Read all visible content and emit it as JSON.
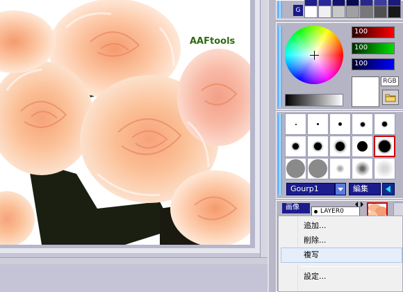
{
  "canvas": {
    "watermark": "AAFtools"
  },
  "swatches": {
    "group_label": "G",
    "colors": [
      "#ffffff",
      "#f4f4f4",
      "#c8c8c8",
      "#a0a0a0",
      "#787878",
      "#505050",
      "#282828",
      "#000000"
    ],
    "top_row": [
      "#1e1e8c",
      "#2828a0",
      "#14146e",
      "#0a0a50",
      "#28288c",
      "#3c3ca0",
      "#1a1a7a",
      "#0a0a40"
    ]
  },
  "color_picker": {
    "red_value": "100",
    "green_value": "100",
    "blue_value": "100",
    "mode_label": "RGB",
    "preview_color": "#ffffff"
  },
  "brushes": {
    "group_select": "Gourp1",
    "edit_label": "編集"
  },
  "layers": {
    "tab_label": "画像",
    "layer_name": "LAYER0"
  },
  "context_menu": {
    "items": [
      {
        "label": "追加..."
      },
      {
        "label": "削除..."
      },
      {
        "label": "複写"
      },
      {
        "label": "設定..."
      }
    ]
  }
}
